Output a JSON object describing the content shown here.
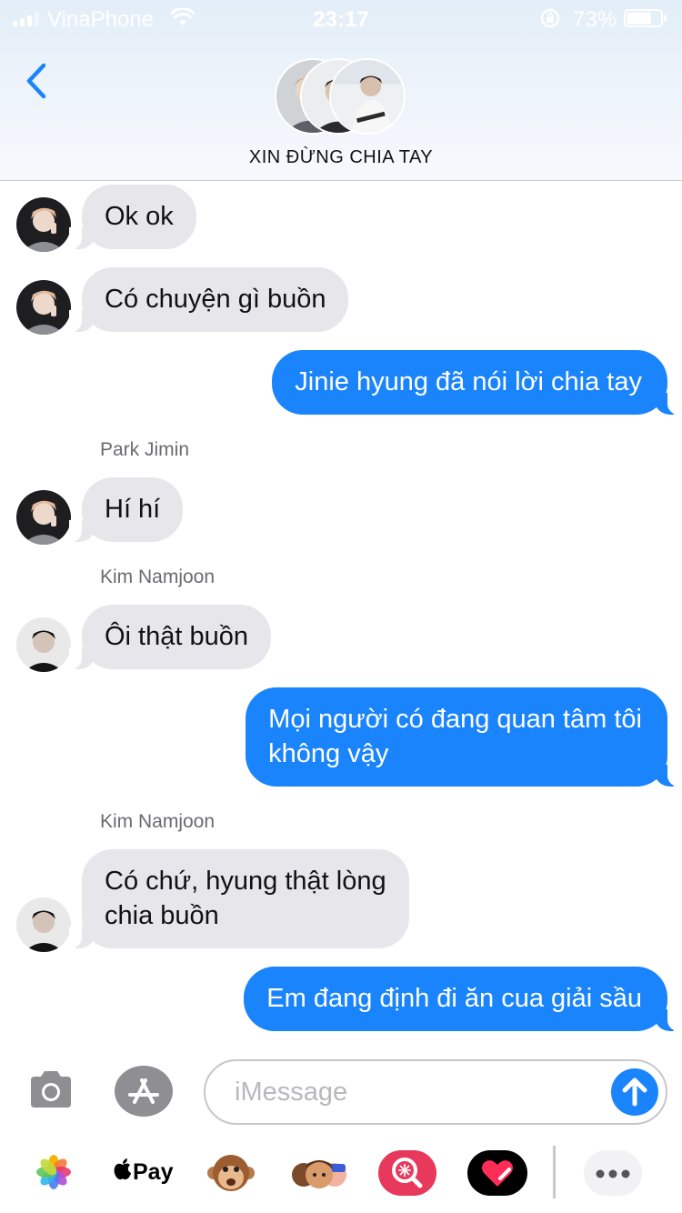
{
  "status_bar": {
    "carrier": "VinaPhone",
    "time": "23:17",
    "battery_percent": "73%",
    "battery_level": 0.73
  },
  "header": {
    "group_name": "XIN ĐỪNG CHIA TAY"
  },
  "messages": [
    {
      "text": "Ok ok",
      "incoming": true
    },
    {
      "text": "Có chuyện gì buồn",
      "incoming": true
    },
    {
      "text": "Jinie hyung đã nói lời chia tay",
      "incoming": false
    },
    {
      "sender": "Park Jimin",
      "text": "Hí hí",
      "incoming": true
    },
    {
      "sender": "Kim Namjoon",
      "text": "Ôi thật buồn",
      "incoming": true
    },
    {
      "text_line1": "Mọi người có đang quan tâm tôi",
      "text_line2": "không vậy",
      "incoming": false
    },
    {
      "sender": "Kim Namjoon",
      "text_line1": "Có chứ, hyung thật lòng",
      "text_line2": "chia buồn",
      "incoming": true
    },
    {
      "text": "Em đang định đi ăn cua giải sầu",
      "incoming": false
    }
  ],
  "compose": {
    "placeholder": "iMessage"
  },
  "app_drawer": {
    "pay_label": "Pay"
  },
  "colors": {
    "outgoing_bubble": "#1a84fc",
    "incoming_bubble": "#e6e6eb",
    "accent": "#1a84fc"
  }
}
